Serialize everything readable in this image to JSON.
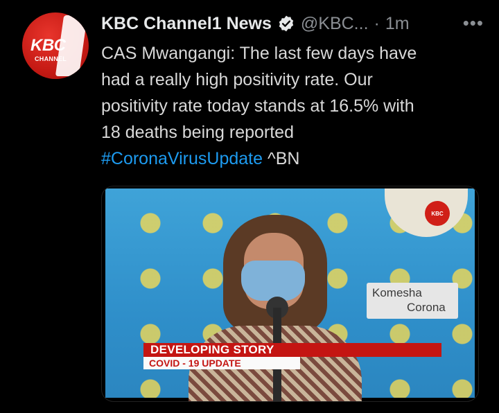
{
  "tweet": {
    "avatar": {
      "logo_text": "KBC",
      "logo_subtext": "CHANNEL",
      "brand_color": "#d01f17"
    },
    "author": {
      "name": "KBC Channel1 News",
      "handle": "@KBC...",
      "separator": "·",
      "time": "1m",
      "verified_icon": "verified-badge-icon"
    },
    "more_label": "•••",
    "text": {
      "line1": "CAS Mwangangi: The last few days have",
      "line2": "had a really high positivity rate. Our",
      "line3": "positivity rate today stands at 16.5% with",
      "line4": "18 deaths being reported",
      "hashtag": "#CoronaVirusUpdate",
      "suffix": " ^BN"
    },
    "media": {
      "sign_line1": "Komesha",
      "sign_line2": "Corona",
      "channel_logo": "KBC",
      "banner_main": "DEVELOPING STORY",
      "banner_sub": "COVID - 19 UPDATE"
    },
    "colors": {
      "link": "#1d9bf0",
      "banner_red": "#c41512"
    }
  }
}
